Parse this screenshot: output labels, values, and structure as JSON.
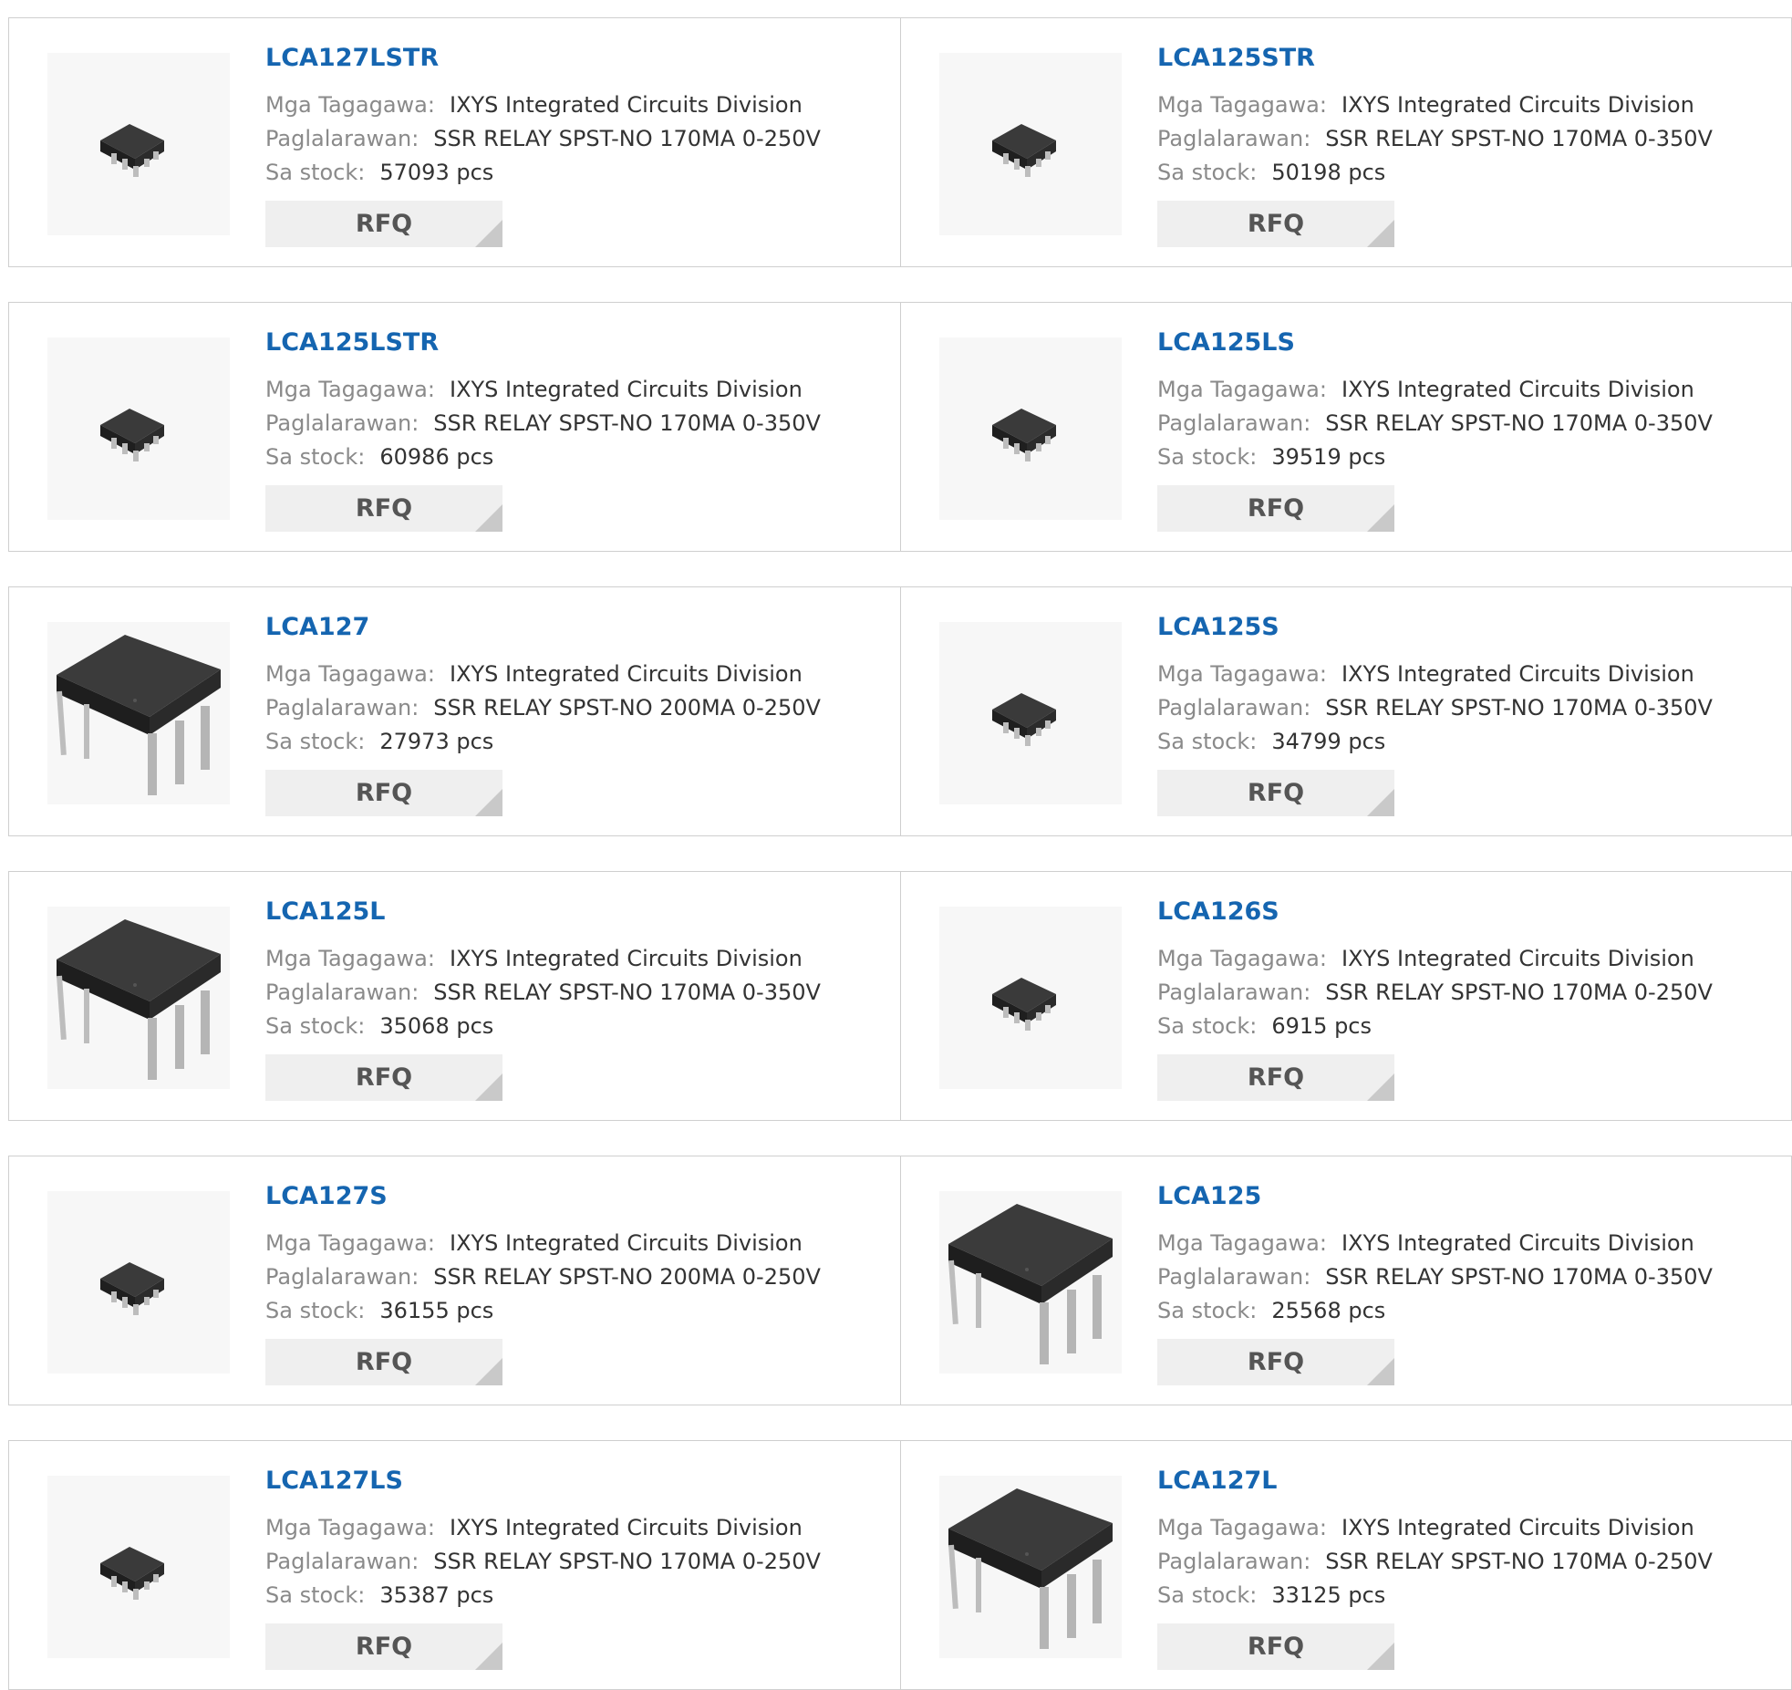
{
  "labels": {
    "manufacturer": "Mga Tagagawa:",
    "description": "Paglalarawan:",
    "stock": "Sa stock:",
    "rfq": "RFQ"
  },
  "rows": [
    [
      {
        "part": "LCA127LSTR",
        "manufacturer": "IXYS Integrated Circuits Division",
        "description": "SSR RELAY SPST-NO 170MA 0-250V",
        "stock": "57093 pcs",
        "image": "smd-chip-icon"
      },
      {
        "part": "LCA125STR",
        "manufacturer": "IXYS Integrated Circuits Division",
        "description": "SSR RELAY SPST-NO 170MA 0-350V",
        "stock": "50198 pcs",
        "image": "smd-chip-icon"
      }
    ],
    [
      {
        "part": "LCA125LSTR",
        "manufacturer": "IXYS Integrated Circuits Division",
        "description": "SSR RELAY SPST-NO 170MA 0-350V",
        "stock": "60986 pcs",
        "image": "smd-chip-icon"
      },
      {
        "part": "LCA125LS",
        "manufacturer": "IXYS Integrated Circuits Division",
        "description": "SSR RELAY SPST-NO 170MA 0-350V",
        "stock": "39519 pcs",
        "image": "smd-chip-icon"
      }
    ],
    [
      {
        "part": "LCA127",
        "manufacturer": "IXYS Integrated Circuits Division",
        "description": "SSR RELAY SPST-NO 200MA 0-250V",
        "stock": "27973 pcs",
        "image": "dip-chip-icon"
      },
      {
        "part": "LCA125S",
        "manufacturer": "IXYS Integrated Circuits Division",
        "description": "SSR RELAY SPST-NO 170MA 0-350V",
        "stock": "34799 pcs",
        "image": "smd-chip-icon"
      }
    ],
    [
      {
        "part": "LCA125L",
        "manufacturer": "IXYS Integrated Circuits Division",
        "description": "SSR RELAY SPST-NO 170MA 0-350V",
        "stock": "35068 pcs",
        "image": "dip-chip-icon"
      },
      {
        "part": "LCA126S",
        "manufacturer": "IXYS Integrated Circuits Division",
        "description": "SSR RELAY SPST-NO 170MA 0-250V",
        "stock": "6915 pcs",
        "image": "smd-chip-icon"
      }
    ],
    [
      {
        "part": "LCA127S",
        "manufacturer": "IXYS Integrated Circuits Division",
        "description": "SSR RELAY SPST-NO 200MA 0-250V",
        "stock": "36155 pcs",
        "image": "smd-chip-icon"
      },
      {
        "part": "LCA125",
        "manufacturer": "IXYS Integrated Circuits Division",
        "description": "SSR RELAY SPST-NO 170MA 0-350V",
        "stock": "25568 pcs",
        "image": "dip-chip-icon"
      }
    ],
    [
      {
        "part": "LCA127LS",
        "manufacturer": "IXYS Integrated Circuits Division",
        "description": "SSR RELAY SPST-NO 170MA 0-250V",
        "stock": "35387 pcs",
        "image": "smd-chip-icon"
      },
      {
        "part": "LCA127L",
        "manufacturer": "IXYS Integrated Circuits Division",
        "description": "SSR RELAY SPST-NO 170MA 0-250V",
        "stock": "33125 pcs",
        "image": "dip-chip-icon"
      }
    ]
  ]
}
